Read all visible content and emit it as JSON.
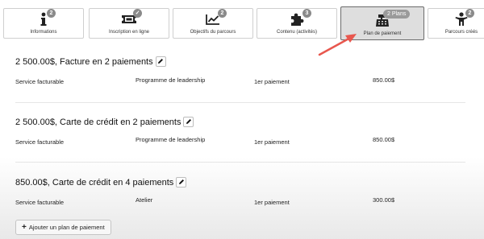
{
  "tabs": [
    {
      "label": "Informations",
      "badge": "2",
      "icon": "info-icon"
    },
    {
      "label": "Inscription en ligne",
      "badge": "✓",
      "icon": "ticket-icon"
    },
    {
      "label": "Objectifs du parcours",
      "badge": "2",
      "icon": "chart-icon"
    },
    {
      "label": "Contenu (activités)",
      "badge": "3",
      "icon": "puzzle-icon"
    },
    {
      "label": "Plan de paiement",
      "badge": "2 Plans",
      "icon": "cash-register-icon",
      "active": true
    },
    {
      "label": "Parcours créés",
      "badge": "2",
      "icon": "person-icon"
    }
  ],
  "plans": [
    {
      "title": "2 500.00$, Facture en 2 paiements",
      "service": "Service facturable",
      "program": "Programme de leadership",
      "payment": "1er paiement",
      "amount": "850.00$"
    },
    {
      "title": "2 500.00$, Carte de crédit en 2 paiements",
      "service": "Service facturable",
      "program": "Programme de leadership",
      "payment": "1er paiement",
      "amount": "850.00$"
    },
    {
      "title": "850.00$, Carte de crédit en 4 paiements",
      "service": "Service facturable",
      "program": "Atelier",
      "payment": "1er paiement",
      "amount": "300.00$"
    }
  ],
  "add_button_label": "Ajouter un plan de paiement",
  "colors": {
    "active_tab_bg": "#dedede",
    "badge": "#8a8a8a",
    "annotation_arrow": "#e8574e"
  }
}
